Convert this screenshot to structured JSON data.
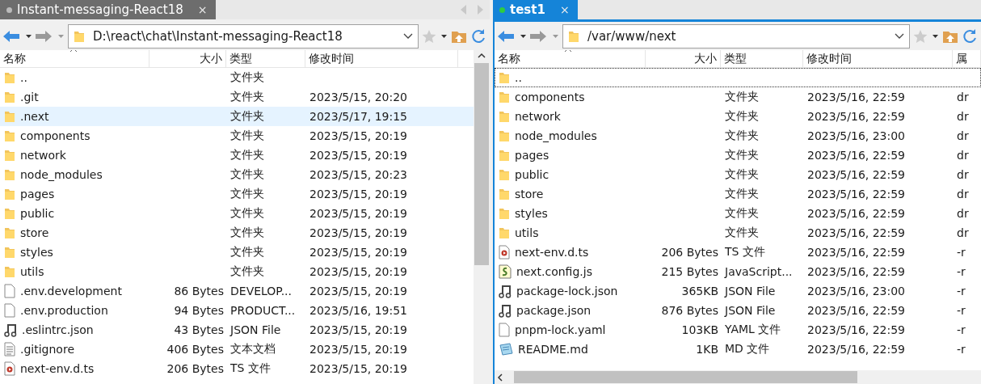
{
  "panes": [
    {
      "tab": {
        "title": "Instant-messaging-React18",
        "close": "×",
        "selected": false,
        "connected": false
      },
      "path": "D:\\react\\chat\\Instant-messaging-React18",
      "columns": [
        "名称",
        "大小",
        "类型",
        "修改时间"
      ],
      "rows": [
        {
          "kind": "folder",
          "name": "..",
          "type": "文件夹",
          "selected": false
        },
        {
          "kind": "folder",
          "name": ".git",
          "type": "文件夹",
          "modified": "2023/5/15, 20:20",
          "selected": false
        },
        {
          "kind": "folder",
          "name": ".next",
          "type": "文件夹",
          "modified": "2023/5/17, 19:15",
          "selected": true
        },
        {
          "kind": "folder",
          "name": "components",
          "type": "文件夹",
          "modified": "2023/5/15, 20:19",
          "selected": false
        },
        {
          "kind": "folder",
          "name": "network",
          "type": "文件夹",
          "modified": "2023/5/15, 20:19",
          "selected": false
        },
        {
          "kind": "folder",
          "name": "node_modules",
          "type": "文件夹",
          "modified": "2023/5/15, 20:23",
          "selected": false
        },
        {
          "kind": "folder",
          "name": "pages",
          "type": "文件夹",
          "modified": "2023/5/15, 20:19",
          "selected": false
        },
        {
          "kind": "folder",
          "name": "public",
          "type": "文件夹",
          "modified": "2023/5/15, 20:19",
          "selected": false
        },
        {
          "kind": "folder",
          "name": "store",
          "type": "文件夹",
          "modified": "2023/5/15, 20:19",
          "selected": false
        },
        {
          "kind": "folder",
          "name": "styles",
          "type": "文件夹",
          "modified": "2023/5/15, 20:19",
          "selected": false
        },
        {
          "kind": "folder",
          "name": "utils",
          "type": "文件夹",
          "modified": "2023/5/15, 20:19",
          "selected": false
        },
        {
          "kind": "file",
          "name": ".env.development",
          "size": "86 Bytes",
          "type": "DEVELOP...",
          "modified": "2023/5/15, 20:19",
          "selected": false
        },
        {
          "kind": "file",
          "name": ".env.production",
          "size": "94 Bytes",
          "type": "PRODUCT...",
          "modified": "2023/5/16, 19:51",
          "selected": false
        },
        {
          "kind": "json",
          "name": ".eslintrc.json",
          "size": "43 Bytes",
          "type": "JSON File",
          "modified": "2023/5/15, 20:19",
          "selected": false
        },
        {
          "kind": "text",
          "name": ".gitignore",
          "size": "406 Bytes",
          "type": "文本文档",
          "modified": "2023/5/15, 20:19",
          "selected": false
        },
        {
          "kind": "ts",
          "name": "next-env.d.ts",
          "size": "206 Bytes",
          "type": "TS 文件",
          "modified": "2023/5/15, 20:19",
          "selected": false
        }
      ]
    },
    {
      "tab": {
        "title": "test1",
        "close": "×",
        "selected": true,
        "connected": true
      },
      "path": "/var/www/next",
      "columns": [
        "名称",
        "大小",
        "类型",
        "修改时间",
        "属"
      ],
      "rows": [
        {
          "kind": "folder",
          "name": "..",
          "selected": true
        },
        {
          "kind": "folder",
          "name": "components",
          "type": "文件夹",
          "modified": "2023/5/16, 22:59",
          "attributes": "dr",
          "selected": false
        },
        {
          "kind": "folder",
          "name": "network",
          "type": "文件夹",
          "modified": "2023/5/16, 22:59",
          "attributes": "dr",
          "selected": false
        },
        {
          "kind": "folder",
          "name": "node_modules",
          "type": "文件夹",
          "modified": "2023/5/16, 23:00",
          "attributes": "dr",
          "selected": false
        },
        {
          "kind": "folder",
          "name": "pages",
          "type": "文件夹",
          "modified": "2023/5/16, 22:59",
          "attributes": "dr",
          "selected": false
        },
        {
          "kind": "folder",
          "name": "public",
          "type": "文件夹",
          "modified": "2023/5/16, 22:59",
          "attributes": "dr",
          "selected": false
        },
        {
          "kind": "folder",
          "name": "store",
          "type": "文件夹",
          "modified": "2023/5/16, 22:59",
          "attributes": "dr",
          "selected": false
        },
        {
          "kind": "folder",
          "name": "styles",
          "type": "文件夹",
          "modified": "2023/5/16, 22:59",
          "attributes": "dr",
          "selected": false
        },
        {
          "kind": "folder",
          "name": "utils",
          "type": "文件夹",
          "modified": "2023/5/16, 22:59",
          "attributes": "dr",
          "selected": false
        },
        {
          "kind": "ts",
          "name": "next-env.d.ts",
          "size": "206 Bytes",
          "type": "TS 文件",
          "modified": "2023/5/16, 22:59",
          "attributes": "-r",
          "selected": false
        },
        {
          "kind": "js",
          "name": "next.config.js",
          "size": "215 Bytes",
          "type": "JavaScript...",
          "modified": "2023/5/16, 22:59",
          "attributes": "-r",
          "selected": false
        },
        {
          "kind": "json",
          "name": "package-lock.json",
          "size": "365KB",
          "type": "JSON File",
          "modified": "2023/5/16, 23:00",
          "attributes": "-r",
          "selected": false
        },
        {
          "kind": "json",
          "name": "package.json",
          "size": "876 Bytes",
          "type": "JSON File",
          "modified": "2023/5/16, 22:59",
          "attributes": "-r",
          "selected": false
        },
        {
          "kind": "file",
          "name": "pnpm-lock.yaml",
          "size": "103KB",
          "type": "YAML 文件",
          "modified": "2023/5/16, 22:59",
          "attributes": "-r",
          "selected": false
        },
        {
          "kind": "md",
          "name": "README.md",
          "size": "1KB",
          "type": "MD 文件",
          "modified": "2023/5/16, 22:59",
          "attributes": "-r",
          "selected": false
        }
      ]
    }
  ]
}
